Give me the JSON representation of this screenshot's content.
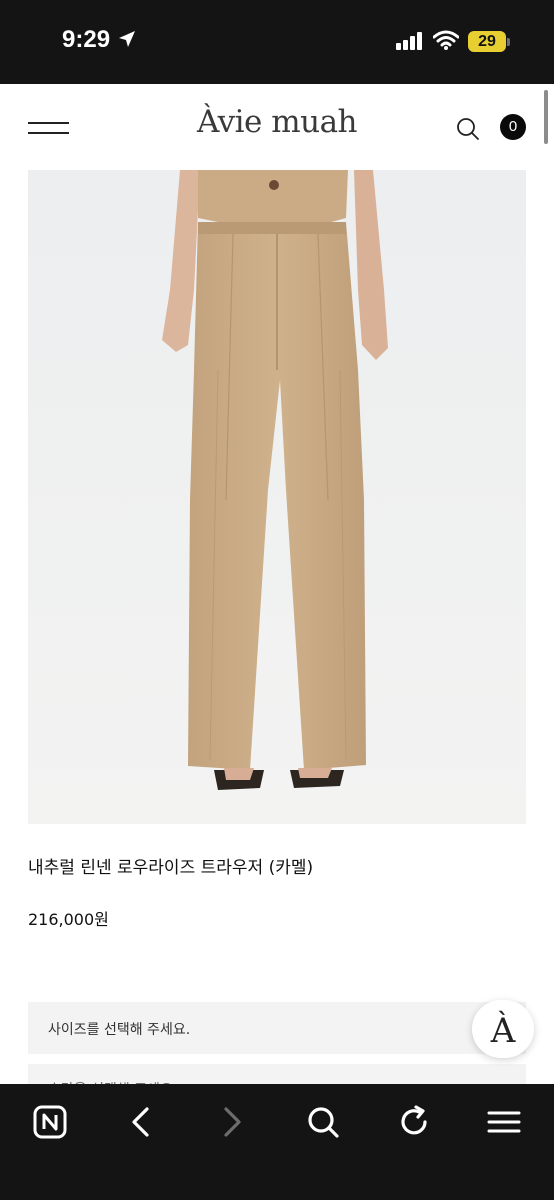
{
  "status_bar": {
    "time": "9:29",
    "battery": "29",
    "icons": [
      "location-arrow-icon",
      "signal-icon",
      "wifi-icon",
      "battery-icon"
    ]
  },
  "header": {
    "brand": "Àvie muah",
    "cart_count": "0",
    "icons": [
      "hamburger-menu-icon",
      "search-icon"
    ]
  },
  "product": {
    "name": "내추럴 린넨 로우라이즈 트라우저 (카멜)",
    "price": "216,000원",
    "image_colors": {
      "background": "#eeeff0",
      "trousers": "#c9ab86",
      "skin": "#dcb59d"
    }
  },
  "options": {
    "size_placeholder": "사이즈를 선택해 주세요.",
    "second_placeholder": "수량을 선택해 주세요."
  },
  "floating_button": {
    "label": "À"
  },
  "toolbar": {
    "icons": [
      "n-home-icon",
      "back-icon",
      "forward-icon",
      "search-icon",
      "refresh-icon",
      "menu-icon"
    ]
  },
  "colors": {
    "bars": "#141414",
    "battery": "#e7cf32",
    "select_bg": "#f3f3f3"
  }
}
